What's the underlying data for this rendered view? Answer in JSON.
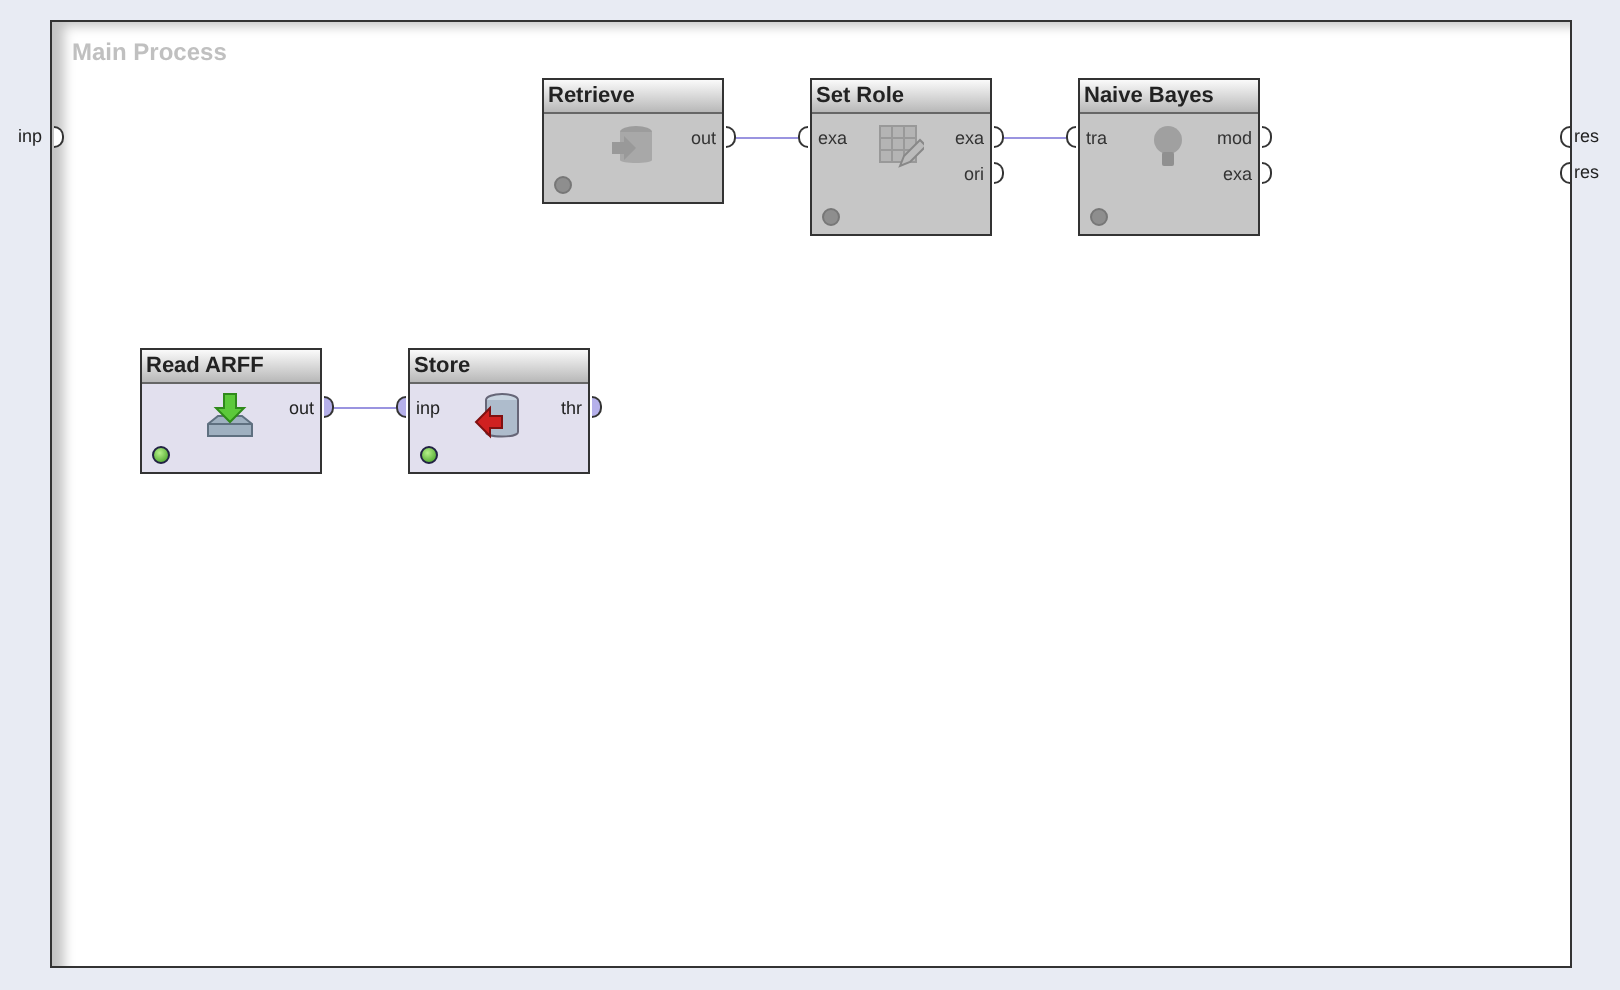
{
  "process": {
    "title": "Main Process",
    "inputs": [
      {
        "label": "inp",
        "filled": false
      }
    ],
    "outputs": [
      {
        "label": "res",
        "filled": false
      },
      {
        "label": "res",
        "filled": false
      }
    ]
  },
  "operators": [
    {
      "name": "Retrieve",
      "kind": "retrieve",
      "enabled": false,
      "outputs": [
        {
          "label": "out",
          "filled": false,
          "connected": true
        }
      ]
    },
    {
      "name": "Set Role",
      "kind": "set-role",
      "enabled": false,
      "inputs": [
        {
          "label": "exa",
          "filled": false
        }
      ],
      "outputs": [
        {
          "label": "exa",
          "filled": false,
          "connected": true
        },
        {
          "label": "ori",
          "filled": false
        }
      ]
    },
    {
      "name": "Naive Bayes",
      "kind": "naive-bayes",
      "enabled": false,
      "inputs": [
        {
          "label": "tra",
          "filled": false
        }
      ],
      "outputs": [
        {
          "label": "mod",
          "filled": false
        },
        {
          "label": "exa",
          "filled": false
        }
      ]
    },
    {
      "name": "Read ARFF",
      "kind": "read",
      "enabled": true,
      "outputs": [
        {
          "label": "out",
          "filled": true,
          "connected": true
        }
      ]
    },
    {
      "name": "Store",
      "kind": "store",
      "enabled": true,
      "inputs": [
        {
          "label": "inp",
          "filled": true
        }
      ],
      "outputs": [
        {
          "label": "thr",
          "filled": true
        }
      ]
    }
  ]
}
